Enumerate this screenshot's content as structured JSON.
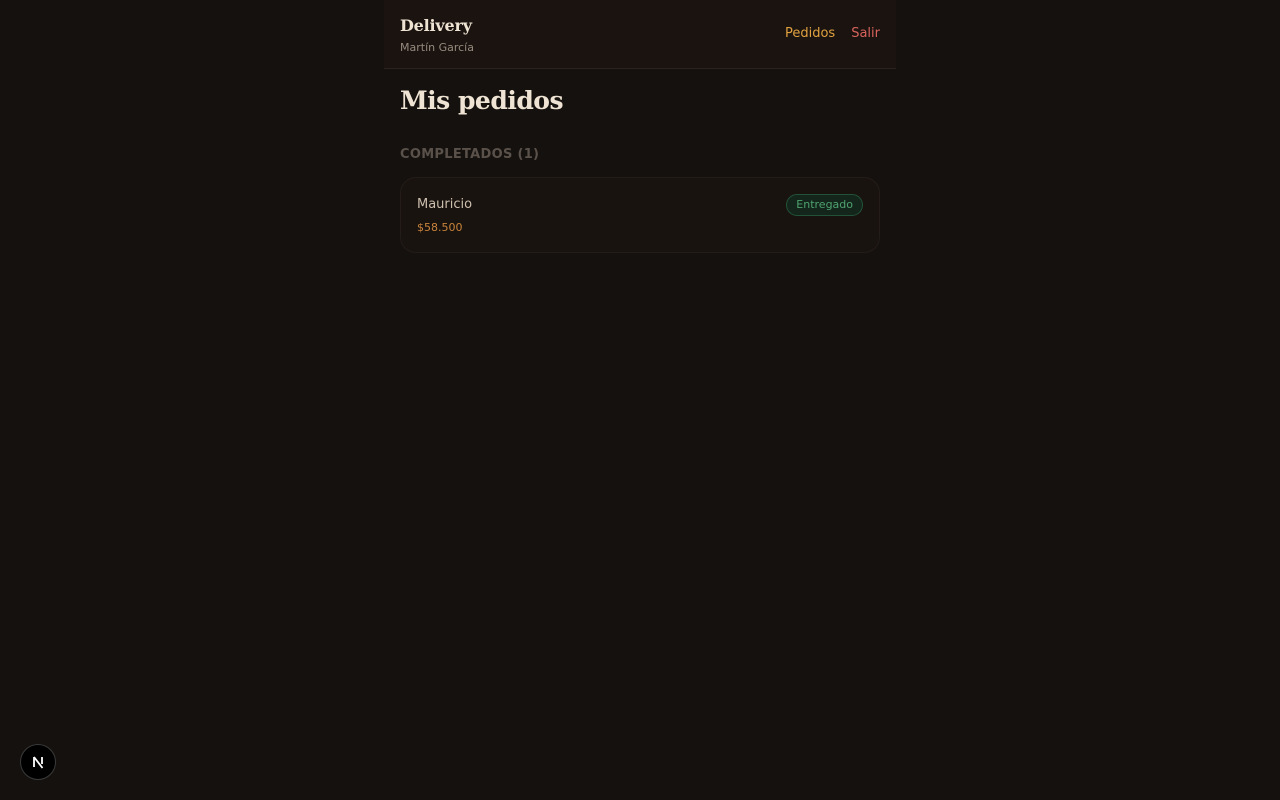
{
  "header": {
    "title": "Delivery",
    "user_name": "Martín García",
    "nav": {
      "orders_label": "Pedidos",
      "logout_label": "Salir"
    }
  },
  "main": {
    "title": "Mis pedidos",
    "sections": [
      {
        "label": "COMPLETADOS (1)",
        "orders": [
          {
            "name": "Mauricio",
            "price": "$58.500",
            "status": "Entregado"
          }
        ]
      }
    ]
  },
  "dev_badge": {
    "icon": "nextjs-logo-icon"
  },
  "colors": {
    "background": "#15110e",
    "accent": "#e0a13f",
    "logout": "#d8635c",
    "price": "#c8833b",
    "status_delivered": "#4ea26f"
  }
}
